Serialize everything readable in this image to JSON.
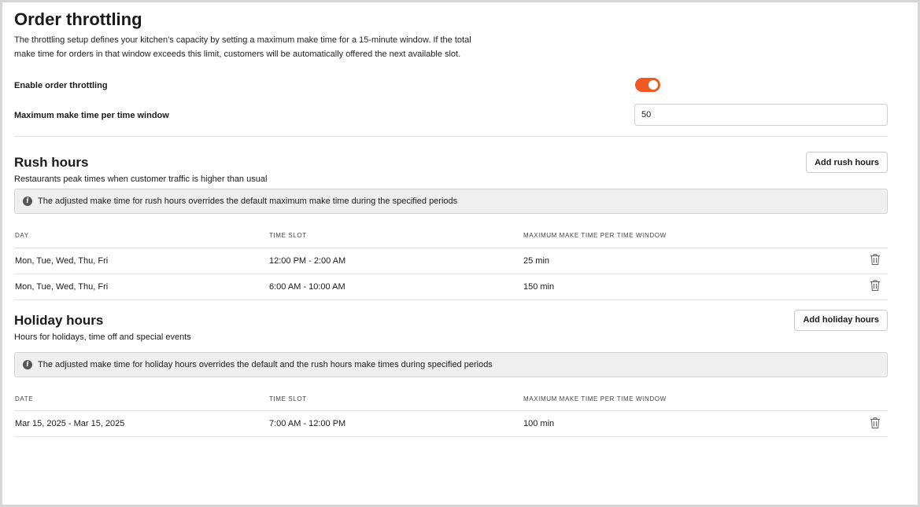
{
  "page": {
    "title": "Order throttling",
    "description": "The throttling setup defines your kitchen’s capacity by setting a maximum make time for a 15-minute window. If the total make time for orders in that window exceeds this limit, customers will be automatically offered the next available slot."
  },
  "settings": {
    "enable_label": "Enable order throttling",
    "enabled": true,
    "max_label": "Maximum make time per time window",
    "max_value": "50"
  },
  "rush": {
    "title": "Rush hours",
    "subtitle": "Restaurants peak times when customer traffic is higher than usual",
    "add_button": "Add rush hours",
    "notice": "The adjusted make time for rush hours overrides the default maximum make time during the specified periods",
    "columns": [
      "DAY",
      "TIME SLOT",
      "MAXIMUM MAKE TIME PER TIME WINDOW"
    ],
    "rows": [
      {
        "day": "Mon, Tue, Wed, Thu, Fri",
        "slot": "12:00 PM - 2:00 AM",
        "time": "25 min"
      },
      {
        "day": "Mon, Tue, Wed, Thu, Fri",
        "slot": "6:00 AM - 10:00 AM",
        "time": "150 min"
      }
    ]
  },
  "holiday": {
    "title": "Holiday hours",
    "subtitle": "Hours for holidays, time off and special events",
    "add_button": "Add holiday hours",
    "notice": "The adjusted make time for holiday hours overrides the default and the rush hours make times during specified periods",
    "columns": [
      "DATE",
      "TIME SLOT",
      "MAXIMUM MAKE TIME PER TIME WINDOW"
    ],
    "rows": [
      {
        "date": "Mar 15, 2025 - Mar 15, 2025",
        "slot": "7:00 AM - 12:00 PM",
        "time": "100 min"
      }
    ]
  },
  "colors": {
    "toggle_on": "#f05a22",
    "notice_bg": "#efefef"
  },
  "icons": {
    "info": "info-icon",
    "delete": "trash-icon"
  }
}
